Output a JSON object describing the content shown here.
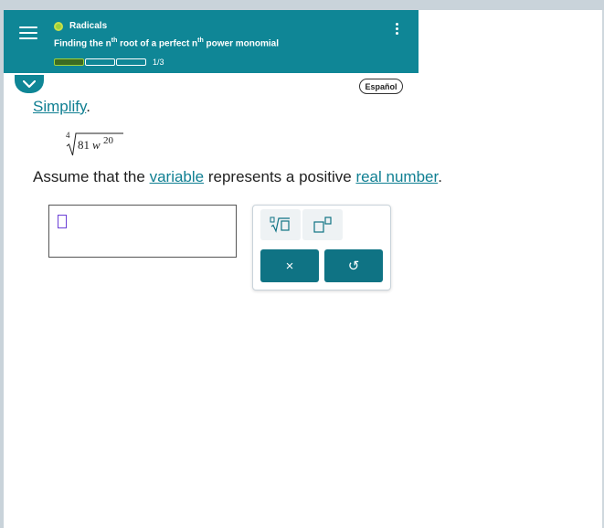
{
  "header": {
    "topic_title": "Radicals",
    "subtitle_part1": "Finding the n",
    "subtitle_sup1": "th",
    "subtitle_part2": " root of a perfect n",
    "subtitle_sup2": "th",
    "subtitle_part3": " power monomial",
    "progress_label": "1/3",
    "progress": {
      "total_segments": 3,
      "filled_segments": 1
    }
  },
  "language_button": "Español",
  "question": {
    "instruction_word": "Simplify",
    "instruction_punct": ".",
    "radical_index": "4",
    "radicand_base": "81",
    "radicand_var": "w",
    "radicand_exp": "20",
    "assume_p1": "Assume that the ",
    "assume_link1": "variable",
    "assume_p2": " represents a positive ",
    "assume_link2": "real number",
    "assume_p3": "."
  },
  "keypad": {
    "nth_root_label": "nth root template",
    "exponent_label": "exponent template",
    "clear_symbol": "×",
    "undo_symbol": "↺"
  },
  "colors": {
    "header_bg": "#0f8696",
    "accent": "#0f7f92",
    "progress_fill": "#3d6b22",
    "keypad_action": "#0f7384",
    "cursor": "#6b3fd6"
  }
}
